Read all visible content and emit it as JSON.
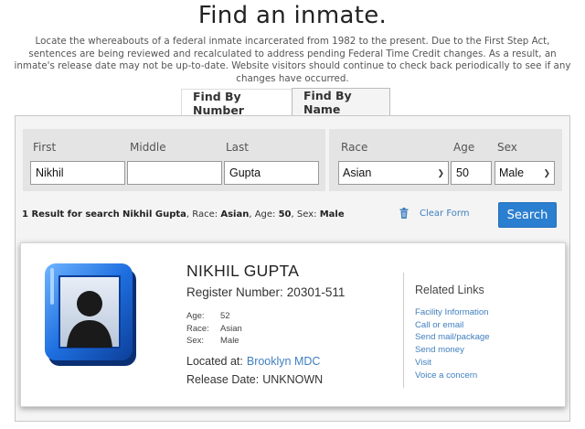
{
  "page": {
    "title": "Find an inmate.",
    "intro": "Locate the whereabouts of a federal inmate incarcerated from 1982 to the present. Due to the First Step Act, sentences are being reviewed and recalculated to address pending Federal Time Credit changes. As a result, an inmate's release date may not be up-to-date. Website visitors should continue to check back periodically to see if any changes have occurred."
  },
  "tabs": [
    {
      "label": "Find By Number",
      "active": false
    },
    {
      "label": "Find By Name",
      "active": true
    }
  ],
  "form": {
    "first_label": "First",
    "middle_label": "Middle",
    "last_label": "Last",
    "first_value": "Nikhil",
    "middle_value": "",
    "last_value": "Gupta",
    "race_label": "Race",
    "race_value": "Asian",
    "age_label": "Age",
    "age_value": "50",
    "sex_label": "Sex",
    "sex_value": "Male",
    "clear_label": "Clear Form",
    "search_label": "Search"
  },
  "result_summary": {
    "prefix": "1 Result for search",
    "name": "Nikhil Gupta",
    "race_label": "Race:",
    "race": "Asian",
    "age_label": "Age:",
    "age": "50",
    "sex_label": "Sex:",
    "sex": "Male"
  },
  "inmate": {
    "name": "NIKHIL GUPTA",
    "register_label": "Register Number:",
    "register_number": "20301-511",
    "age_label": "Age:",
    "age": "52",
    "race_label": "Race:",
    "race": "Asian",
    "sex_label": "Sex:",
    "sex": "Male",
    "located_label": "Located at:",
    "located": "Brooklyn MDC",
    "release_label": "Release Date:",
    "release": "UNKNOWN"
  },
  "related": {
    "title": "Related Links",
    "links": [
      "Facility Information",
      "Call or email",
      "Send mail/package",
      "Send money",
      "Visit",
      "Voice a concern"
    ]
  },
  "colors": {
    "accent": "#2b7fd0",
    "link": "#3f7fbf",
    "avatar_frame": "#1e6fe0"
  }
}
